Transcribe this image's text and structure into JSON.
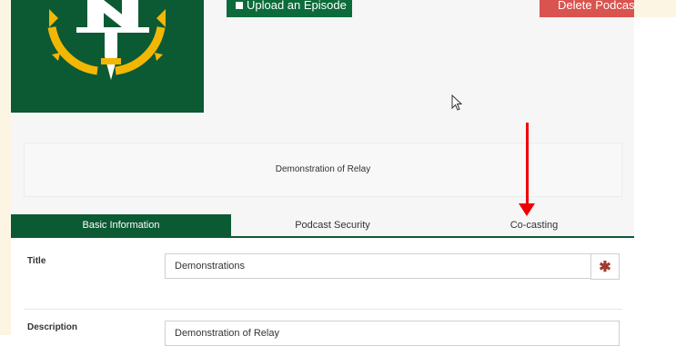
{
  "header": {
    "upload_label": "Upload an Episode",
    "delete_label": "Delete Podcast"
  },
  "podcast": {
    "description_preview": "Demonstration of Relay"
  },
  "tabs": [
    {
      "label": "Basic Information",
      "active": true
    },
    {
      "label": "Podcast Security",
      "active": false
    },
    {
      "label": "Co-casting",
      "active": false
    }
  ],
  "form": {
    "title_label": "Title",
    "title_value": "Demonstrations",
    "required_mark": "✱",
    "description_label": "Description",
    "description_value": "Demonstration of Relay"
  },
  "colors": {
    "brand_green": "#0c5a33",
    "logo_gold": "#f2b705",
    "delete_red": "#d9534f",
    "annotation_red": "#f00000",
    "required_red": "#a33a2f"
  }
}
